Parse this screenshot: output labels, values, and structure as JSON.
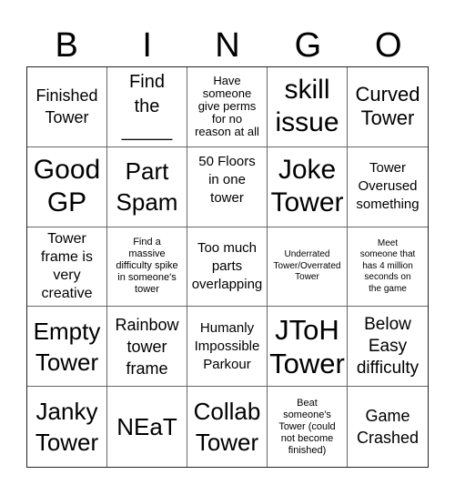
{
  "header": {
    "letters": [
      "B",
      "I",
      "N",
      "G",
      "O"
    ]
  },
  "cells": [
    {
      "text": "Finished\nTower"
    },
    {
      "text": "Find\nthe\n_____"
    },
    {
      "text": "Have\nsomeone\ngive perms\nfor no\nreason at all"
    },
    {
      "text": "skill\nissue"
    },
    {
      "text": "Curved\nTower"
    },
    {
      "text": "Good\nGP"
    },
    {
      "text": "Part\nSpam"
    },
    {
      "text": "50 Floors\nin one\ntower"
    },
    {
      "text": "Joke\nTower"
    },
    {
      "text": "Tower\nOverused\nsomething"
    },
    {
      "text": "Tower\nframe is\nvery\ncreative"
    },
    {
      "text": "Find a\nmassive\ndifficulty spike\nin someone's\ntower"
    },
    {
      "text": "Too much\nparts\noverlapping"
    },
    {
      "text": "Underrated\nTower/Overrated\nTower"
    },
    {
      "text": "Meet\nsomeone that\nhas 4 million\nseconds on\nthe game"
    },
    {
      "text": "Empty\nTower"
    },
    {
      "text": "Rainbow\ntower\nframe"
    },
    {
      "text": "Humanly\nImpossible\nParkour"
    },
    {
      "text": "JToH\nTower"
    },
    {
      "text": "Below\nEasy\ndifficulty"
    },
    {
      "text": "Janky\nTower"
    },
    {
      "text": "NEaT"
    },
    {
      "text": "Collab\nTower"
    },
    {
      "text": "Beat\nsomeone's\nTower (could\nnot become\nfinished)"
    },
    {
      "text": "Game\nCrashed"
    }
  ]
}
